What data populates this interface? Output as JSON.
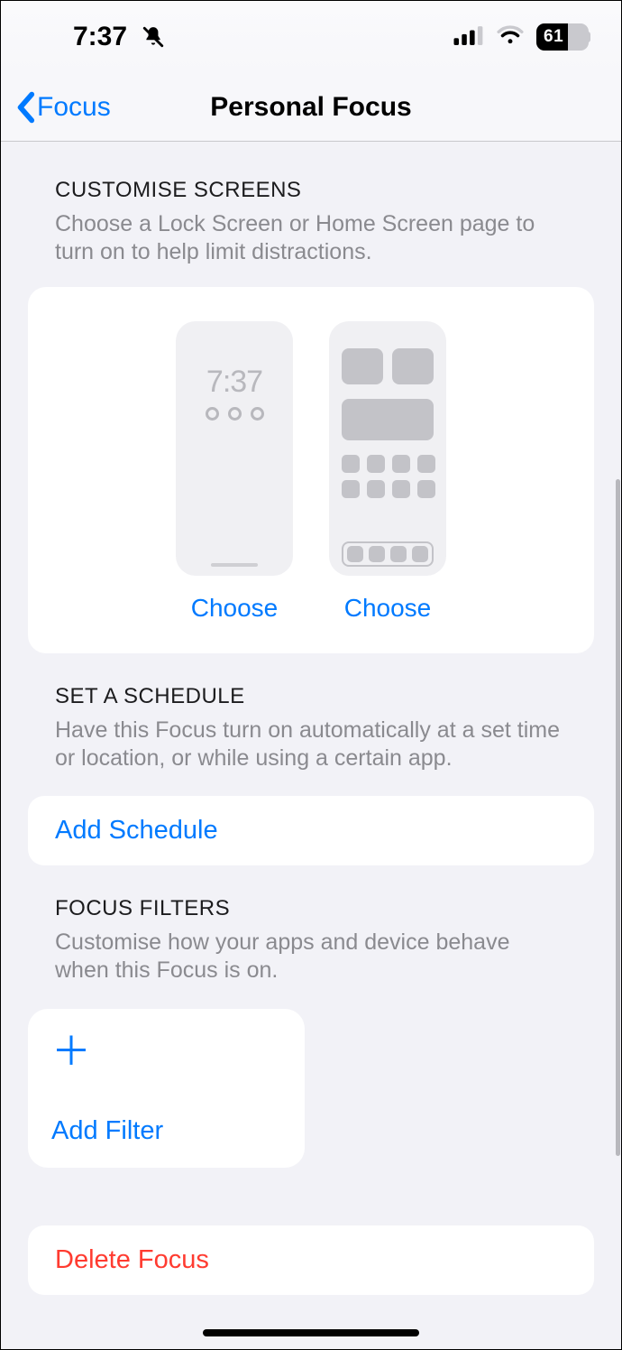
{
  "status": {
    "time": "7:37",
    "battery_pct": "61",
    "silent": true
  },
  "nav": {
    "back_label": "Focus",
    "title": "Personal Focus"
  },
  "customise": {
    "title": "Customise Screens",
    "desc": "Choose a Lock Screen or Home Screen page to turn on to help limit distractions.",
    "lock_preview_time": "7:37",
    "choose_lock": "Choose",
    "choose_home": "Choose"
  },
  "schedule": {
    "title": "Set a Schedule",
    "desc": "Have this Focus turn on automatically at a set time or location, or while using a certain app.",
    "add_label": "Add Schedule"
  },
  "filters": {
    "title": "Focus Filters",
    "desc": "Customise how your apps and device behave when this Focus is on.",
    "add_label": "Add Filter"
  },
  "delete": {
    "label": "Delete Focus"
  }
}
